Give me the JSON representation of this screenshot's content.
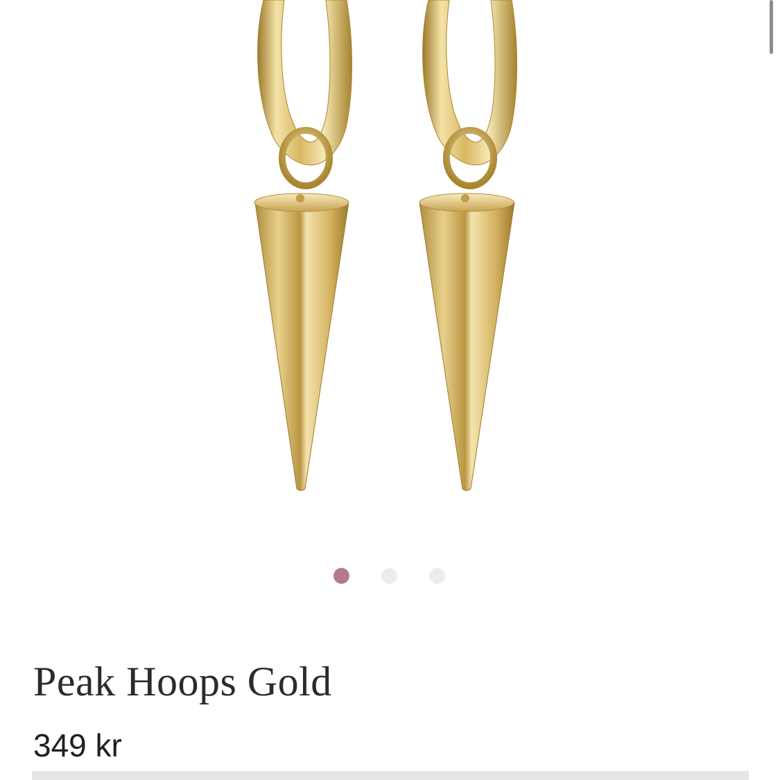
{
  "product": {
    "title": "Peak Hoops Gold",
    "price": "349 kr"
  },
  "gallery": {
    "image_subject": "gold-spike-hoop-earrings",
    "slide_count": 3,
    "active_slide": 1
  },
  "colors": {
    "active_dot": "#b47a8c",
    "inactive_dot": "#ececec",
    "gold_base": "#d6b25e",
    "gold_light": "#f3e3a8",
    "gold_dark": "#9c7a2c"
  }
}
